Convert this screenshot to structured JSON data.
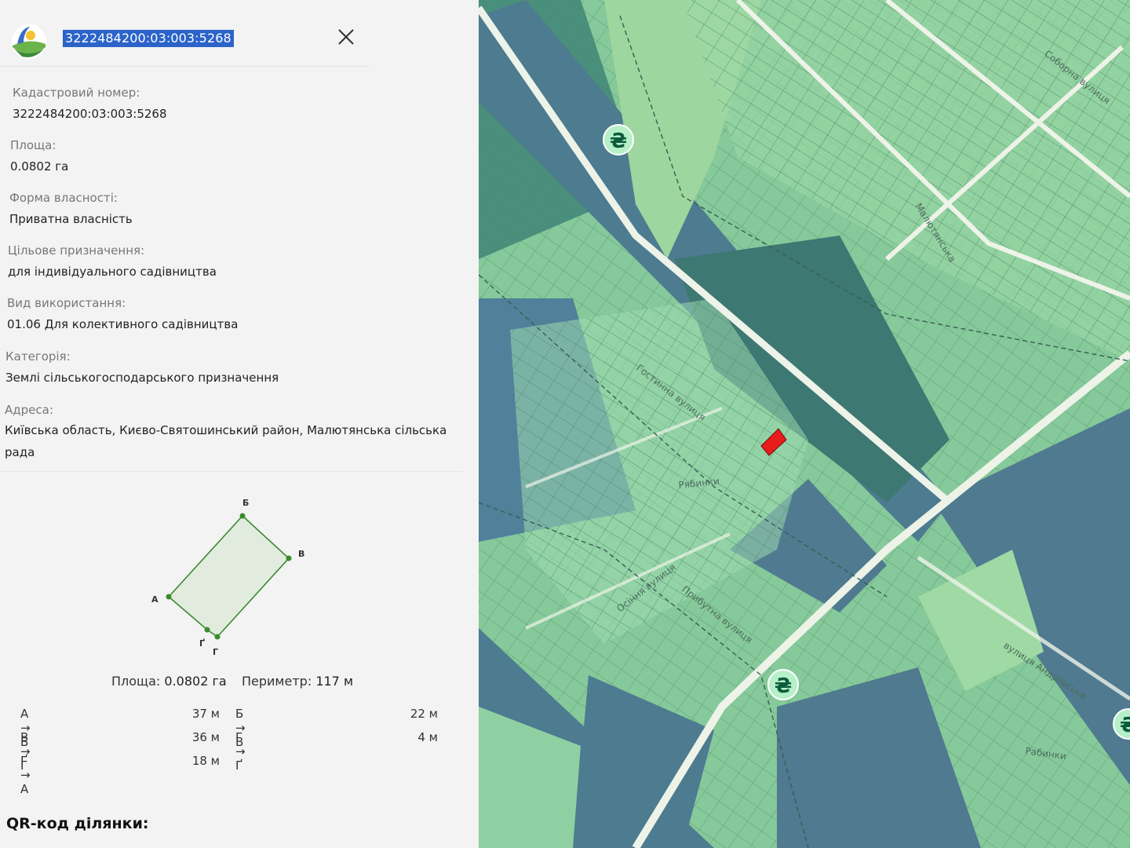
{
  "header": {
    "search_value": "3222484200:03:003:5268",
    "logo_icon": "land-cadastre-logo-icon",
    "close_icon": "close-icon"
  },
  "fields": {
    "cadastral_label": "Кадастровий номер:",
    "cadastral_value": "3222484200:03:003:5268",
    "area_label": "Площа:",
    "area_value": "0.0802 га",
    "ownership_label": "Форма власності:",
    "ownership_value": "Приватна власність",
    "purpose_label": "Цільове призначення:",
    "purpose_value": "для індивідуального садівництва",
    "usage_label": "Вид використання:",
    "usage_value": "01.06 Для колективного садівництва",
    "category_label": "Категорія:",
    "category_value": "Землі сільськогосподарського призначення",
    "address_label": "Адреса:",
    "address_value": "Київська область, Києво-Святошинський район, Малютянська сільська рада"
  },
  "shape": {
    "vertices": [
      "А",
      "Б",
      "В",
      "Г",
      "Ґ"
    ],
    "area_label": "Площа:",
    "area_value": "0.0802 га",
    "perimeter_label": "Периметр:",
    "perimeter_value": "117 м"
  },
  "sides": [
    {
      "name": "А → Б",
      "length": "37 м"
    },
    {
      "name": "Б → В",
      "length": "22 м"
    },
    {
      "name": "В → Г",
      "length": "36 м"
    },
    {
      "name": "Г → Ґ",
      "length": "4 м"
    },
    {
      "name": "Ґ → А",
      "length": "18 м"
    }
  ],
  "qr_title": "QR-код ділянки:",
  "map": {
    "street_labels": [
      "Соборна вулиця",
      "Малютянська",
      "Гостинна вулиця",
      "Рябинки",
      "Осіння вулиця",
      "Прибутна вулиця",
      "вулиця Андріївська",
      "Рабинки"
    ],
    "currency_icon": "hryvnia-icon",
    "currency_symbol": "₴",
    "colors": {
      "parcel_light": "#8fd0a2",
      "parcel_dark": "#3e7d78",
      "parcel_blue": "#4f7a8f",
      "selected_parcel": "#e81c1c",
      "road": "#e9f0e4"
    }
  }
}
